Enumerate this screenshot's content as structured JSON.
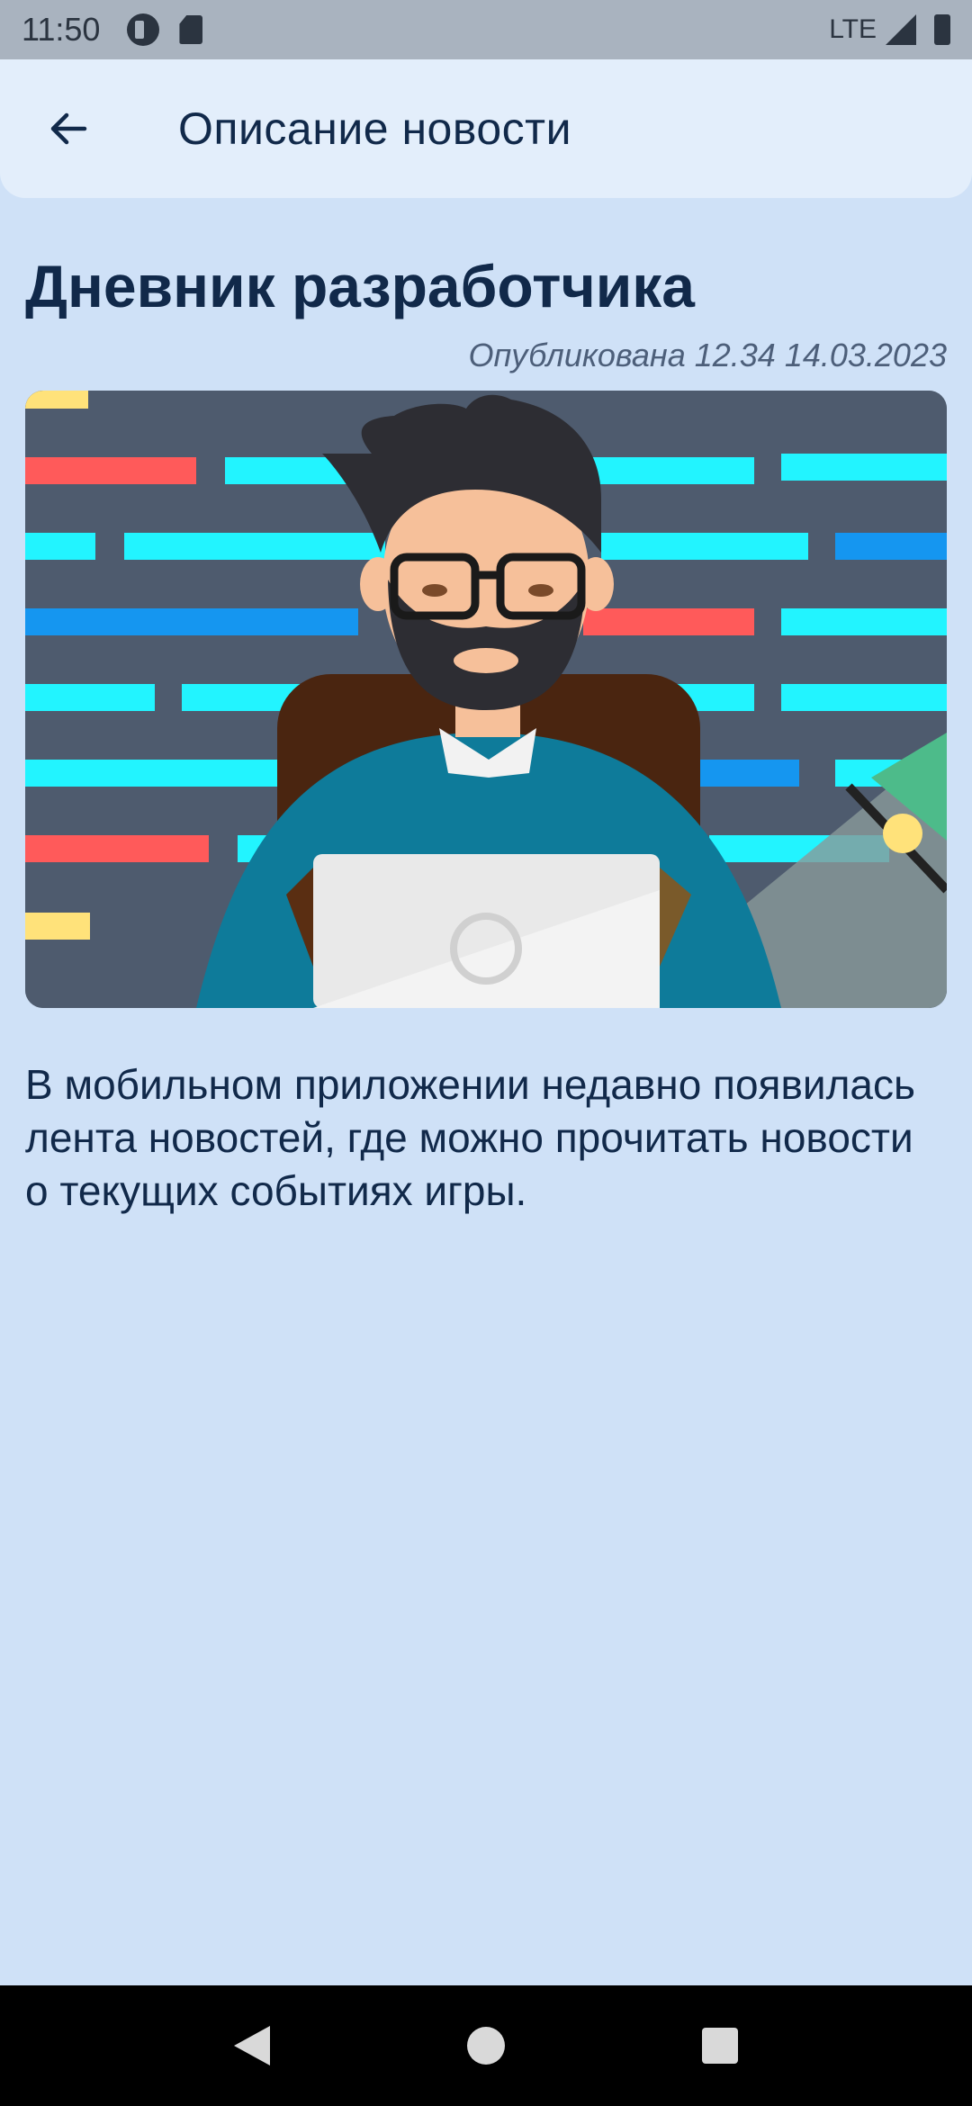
{
  "status_bar": {
    "time": "11:50",
    "network": "LTE",
    "icons": [
      "notification-icon",
      "sd-card-icon",
      "signal-icon",
      "battery-icon"
    ]
  },
  "app_bar": {
    "title": "Описание новости",
    "back_icon": "arrow-left-icon"
  },
  "article": {
    "title": "Дневник разработчика",
    "published": "Опубликована 12.34 14.03.2023",
    "body": "В мобильном приложении недавно появилась лента новостей, где можно прочитать новости о текущих событиях игры."
  },
  "colors": {
    "background": "#cfe1f7",
    "app_bar": "#e3eefb",
    "primary_text": "#11294a",
    "secondary_text": "#4d5f7a"
  },
  "nav_bar": {
    "icons": [
      "nav-back-icon",
      "nav-home-icon",
      "nav-recents-icon"
    ]
  }
}
